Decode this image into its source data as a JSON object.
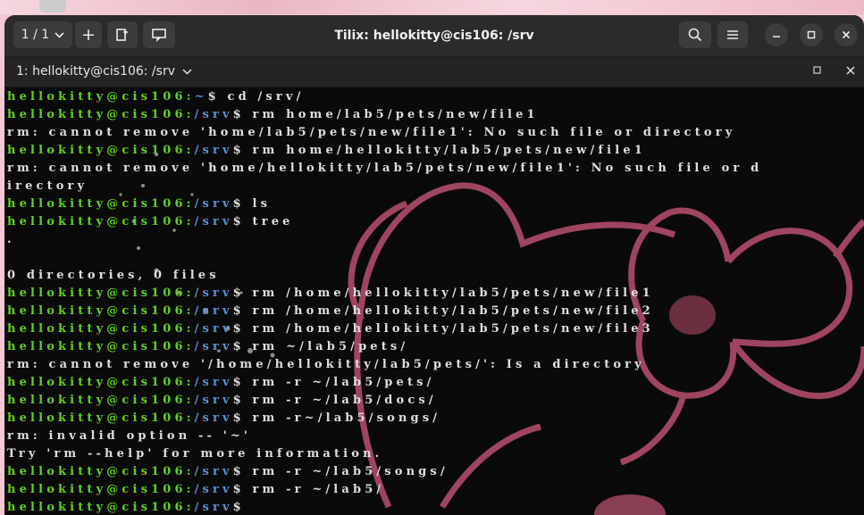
{
  "window": {
    "title": "Tilix: hellokitty@cis106: /srv",
    "session_label": "1 / 1"
  },
  "tab": {
    "label": "1: hellokitty@cis106: /srv"
  },
  "colors": {
    "user_green": "#5fd020",
    "path_blue": "#5b8fcf",
    "output_text": "#dedede",
    "terminal_bg": "#0b0a0b",
    "titlebar_bg": "#2b2b2b",
    "wallpaper_pink": "#c05472"
  },
  "icons": [
    "chevron-down-icon",
    "plus-icon",
    "split-terminal-icon",
    "history-icon",
    "search-icon",
    "hamburger-menu-icon",
    "minimize-icon",
    "maximize-icon",
    "close-icon"
  ],
  "terminal": {
    "lines": [
      {
        "type": "prompt",
        "user": "hellokitty@cis106:",
        "path": "~",
        "symbol": "$",
        "command": " cd /srv/"
      },
      {
        "type": "prompt",
        "user": "hellokitty@cis106:",
        "path": "/srv",
        "symbol": "$",
        "command": " rm home/lab5/pets/new/file1"
      },
      {
        "type": "output",
        "text": "rm: cannot remove 'home/lab5/pets/new/file1': No such file or directory"
      },
      {
        "type": "prompt",
        "user": "hellokitty@cis106:",
        "path": "/srv",
        "symbol": "$",
        "command": " rm home/hellokitty/lab5/pets/new/file1"
      },
      {
        "type": "output",
        "text": "rm: cannot remove 'home/hellokitty/lab5/pets/new/file1': No such file or d"
      },
      {
        "type": "output",
        "text": "irectory"
      },
      {
        "type": "prompt",
        "user": "hellokitty@cis106:",
        "path": "/srv",
        "symbol": "$",
        "command": " ls"
      },
      {
        "type": "prompt",
        "user": "hellokitty@cis106:",
        "path": "/srv",
        "symbol": "$",
        "command": " tree"
      },
      {
        "type": "output",
        "text": "."
      },
      {
        "type": "output",
        "text": ""
      },
      {
        "type": "output",
        "text": "0 directories, 0 files"
      },
      {
        "type": "prompt",
        "user": "hellokitty@cis106:",
        "path": "/srv",
        "symbol": "$",
        "command": " rm /home/hellokitty/lab5/pets/new/file1"
      },
      {
        "type": "prompt",
        "user": "hellokitty@cis106:",
        "path": "/srv",
        "symbol": "$",
        "command": " rm /home/hellokitty/lab5/pets/new/file2"
      },
      {
        "type": "prompt",
        "user": "hellokitty@cis106:",
        "path": "/srv",
        "symbol": "$",
        "command": " rm /home/hellokitty/lab5/pets/new/file3"
      },
      {
        "type": "prompt",
        "user": "hellokitty@cis106:",
        "path": "/srv",
        "symbol": "$",
        "command": " rm ~/lab5/pets/"
      },
      {
        "type": "output",
        "text": "rm: cannot remove '/home/hellokitty/lab5/pets/': Is a directory"
      },
      {
        "type": "prompt",
        "user": "hellokitty@cis106:",
        "path": "/srv",
        "symbol": "$",
        "command": " rm -r ~/lab5/pets/"
      },
      {
        "type": "prompt",
        "user": "hellokitty@cis106:",
        "path": "/srv",
        "symbol": "$",
        "command": " rm -r ~/lab5/docs/"
      },
      {
        "type": "prompt",
        "user": "hellokitty@cis106:",
        "path": "/srv",
        "symbol": "$",
        "command": " rm -r~/lab5/songs/"
      },
      {
        "type": "output",
        "text": "rm: invalid option -- '~'"
      },
      {
        "type": "output",
        "text": "Try 'rm --help' for more information."
      },
      {
        "type": "prompt",
        "user": "hellokitty@cis106:",
        "path": "/srv",
        "symbol": "$",
        "command": " rm -r ~/lab5/songs/"
      },
      {
        "type": "prompt",
        "user": "hellokitty@cis106:",
        "path": "/srv",
        "symbol": "$",
        "command": " rm -r ~/lab5/"
      },
      {
        "type": "prompt",
        "user": "hellokitty@cis106:",
        "path": "/srv",
        "symbol": "$",
        "command": ""
      }
    ]
  }
}
